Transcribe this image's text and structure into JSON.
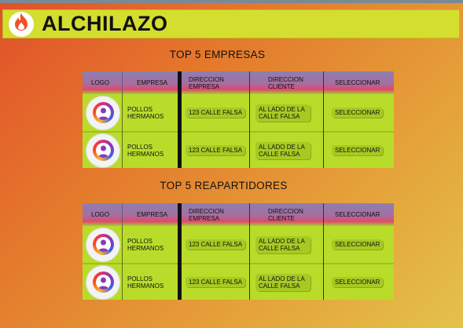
{
  "app": {
    "title": "ALCHILAZO"
  },
  "sections": [
    {
      "title": "TOP 5 EMPRESAS",
      "headers": {
        "logo": "LOGO",
        "empresa": "EMPRESA",
        "dir_empresa": "DIRECCION EMPRESA",
        "dir_cliente": "DIRECCION CLIENTE",
        "seleccionar": "SELECCIONAR"
      },
      "rows": [
        {
          "empresa": "POLLOS HERMANOS",
          "dir_empresa": "123 CALLE FALSA",
          "dir_cliente": "AL LADO DE LA CALLE FALSA",
          "action": "SELECCIONAR"
        },
        {
          "empresa": "POLLOS HERMANOS",
          "dir_empresa": "123 CALLE FALSA",
          "dir_cliente": "AL LADO DE LA CALLE FALSA",
          "action": "SELECCIONAR"
        }
      ]
    },
    {
      "title": "TOP 5  REAPARTIDORES",
      "headers": {
        "logo": "LOGO",
        "empresa": "EMPRESA",
        "dir_empresa": "DIRECCION EMPRESA",
        "dir_cliente": "DIRECCION CLIENTE",
        "seleccionar": "SELECCIONAR"
      },
      "rows": [
        {
          "empresa": "POLLOS HERMANOS",
          "dir_empresa": "123 CALLE FALSA",
          "dir_cliente": "AL LADO DE LA CALLE FALSA",
          "action": "SELECCIONAR"
        },
        {
          "empresa": "POLLOS HERMANOS",
          "dir_empresa": "123 CALLE FALSA",
          "dir_cliente": "AL LADO DE LA CALLE FALSA",
          "action": "SELECCIONAR"
        }
      ]
    }
  ],
  "icons": {
    "app_logo": "flame-icon",
    "row_avatar": "user-avatar-icon"
  },
  "colors": {
    "header_bar": "#d4de2e",
    "table_body": "#b9dc2a",
    "flame": "#f0502a"
  }
}
